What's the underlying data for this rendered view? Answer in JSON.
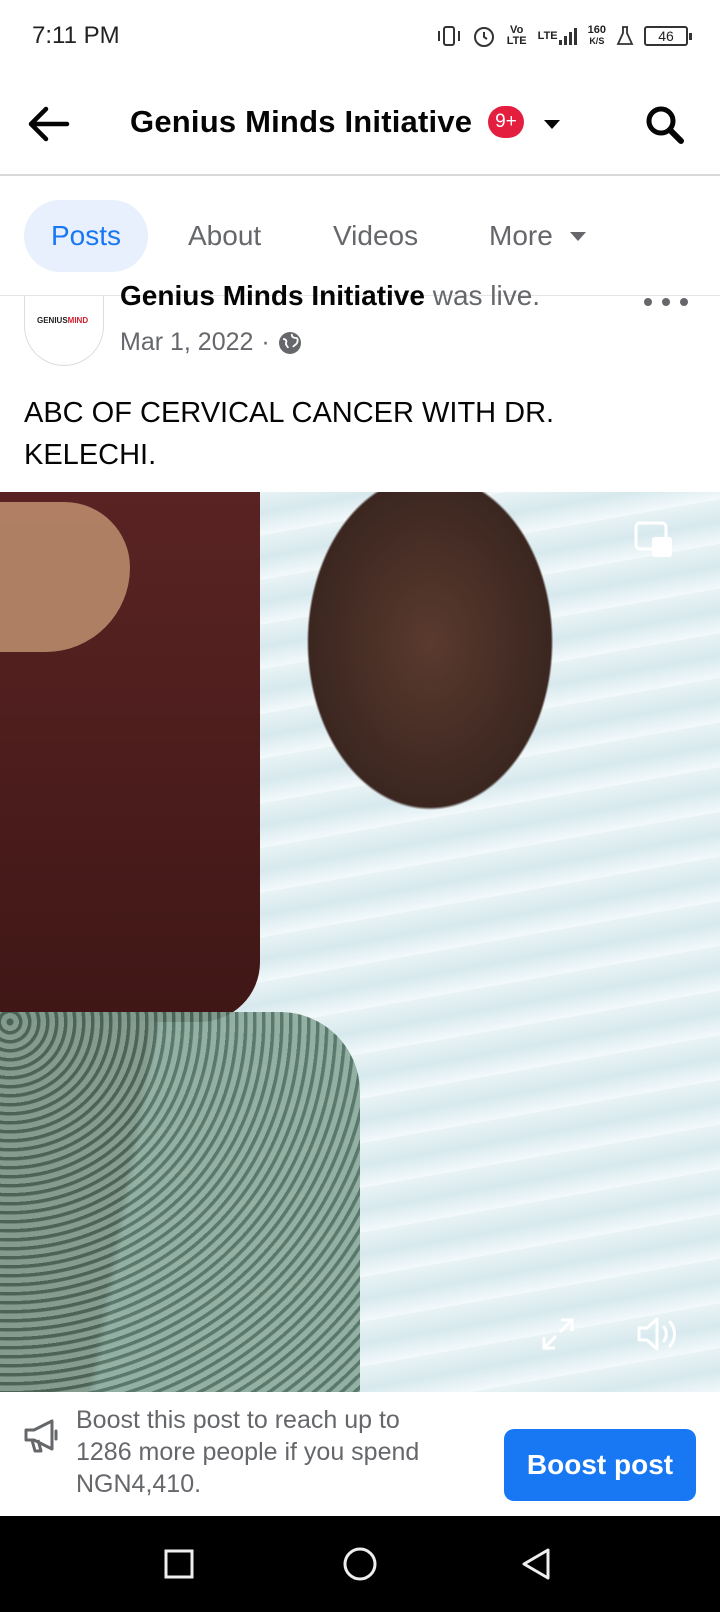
{
  "status_bar": {
    "time": "7:11 PM",
    "volte": "Vo LTE",
    "lte": "LTE",
    "speed_value": "160",
    "speed_unit": "K/S",
    "battery": "46"
  },
  "header": {
    "title": "Genius Minds Initiative",
    "notification_badge": "9+"
  },
  "tabs": [
    {
      "label": "Posts",
      "active": true
    },
    {
      "label": "About",
      "active": false
    },
    {
      "label": "Videos",
      "active": false
    },
    {
      "label": "More",
      "active": false
    }
  ],
  "post": {
    "author": "Genius Minds Initiative",
    "action": "was live.",
    "date": "Mar 1, 2022",
    "separator": "·",
    "avatar_logo_dark": "GENIUS",
    "avatar_logo_red": "MIND",
    "text": "ABC OF CERVICAL CANCER WITH DR. KELECHI."
  },
  "boost": {
    "message": "Boost this post to reach up to 1286 more people if you spend NGN4,410.",
    "button_label": "Boost post"
  },
  "colors": {
    "accent": "#1877f2",
    "badge": "#e41e3f",
    "tab_active_bg": "#e7f0fc",
    "secondary_text": "#65676b"
  },
  "icons": {
    "back": "arrow-left-icon",
    "caret": "caret-down-icon",
    "search": "search-icon",
    "more": "more-dots-icon",
    "globe": "globe-icon",
    "pip": "picture-in-picture-icon",
    "expand": "expand-icon",
    "sound": "speaker-icon",
    "megaphone": "megaphone-icon"
  }
}
